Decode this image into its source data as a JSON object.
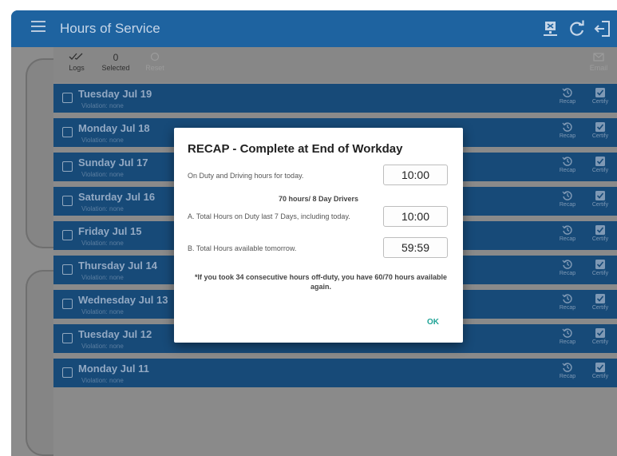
{
  "app": {
    "title": "Hours of Service"
  },
  "colors": {
    "appbar": "#1e63a0",
    "row": "#174a78",
    "accent": "#1fa396"
  },
  "icons": {
    "menu": "hamburger-menu-icon",
    "sync": "upload-device-icon",
    "refresh": "refresh-icon",
    "exit": "logout-icon",
    "recap": "history-icon",
    "certify": "check-box-icon"
  },
  "toolbar": {
    "logs_label": "Logs",
    "selected_count": "0",
    "selected_label": "Selected",
    "reset_label": "Reset",
    "email_label": "Email"
  },
  "logs": [
    {
      "day": "Tuesday Jul 19",
      "violation": "Violation: none",
      "recap": "Recap",
      "certify": "Certify"
    },
    {
      "day": "Monday Jul 18",
      "violation": "Violation: none",
      "recap": "Recap",
      "certify": "Certify"
    },
    {
      "day": "Sunday Jul 17",
      "violation": "Violation: none",
      "recap": "Recap",
      "certify": "Certify"
    },
    {
      "day": "Saturday Jul 16",
      "violation": "Violation: none",
      "recap": "Recap",
      "certify": "Certify"
    },
    {
      "day": "Friday Jul 15",
      "violation": "Violation: none",
      "recap": "Recap",
      "certify": "Certify"
    },
    {
      "day": "Thursday Jul 14",
      "violation": "Violation: none",
      "recap": "Recap",
      "certify": "Certify"
    },
    {
      "day": "Wednesday Jul 13",
      "violation": "Violation: none",
      "recap": "Recap",
      "certify": "Certify"
    },
    {
      "day": "Tuesday Jul 12",
      "violation": "Violation: none",
      "recap": "Recap",
      "certify": "Certify"
    },
    {
      "day": "Monday Jul 11",
      "violation": "Violation: none",
      "recap": "Recap",
      "certify": "Certify"
    }
  ],
  "dialog": {
    "title": "RECAP - Complete at End of Workday",
    "on_duty_label": "On Duty and Driving hours for today.",
    "on_duty_value": "10:00",
    "ruleset": "70 hours/ 8 Day Drivers",
    "total_a_label": "A. Total Hours on Duty last 7 Days, including today.",
    "total_a_value": "10:00",
    "total_b_label": "B. Total Hours available tomorrow.",
    "total_b_value": "59:59",
    "note": "*If you took 34 consecutive hours off-duty, you have 60/70 hours available again.",
    "ok_label": "OK"
  }
}
